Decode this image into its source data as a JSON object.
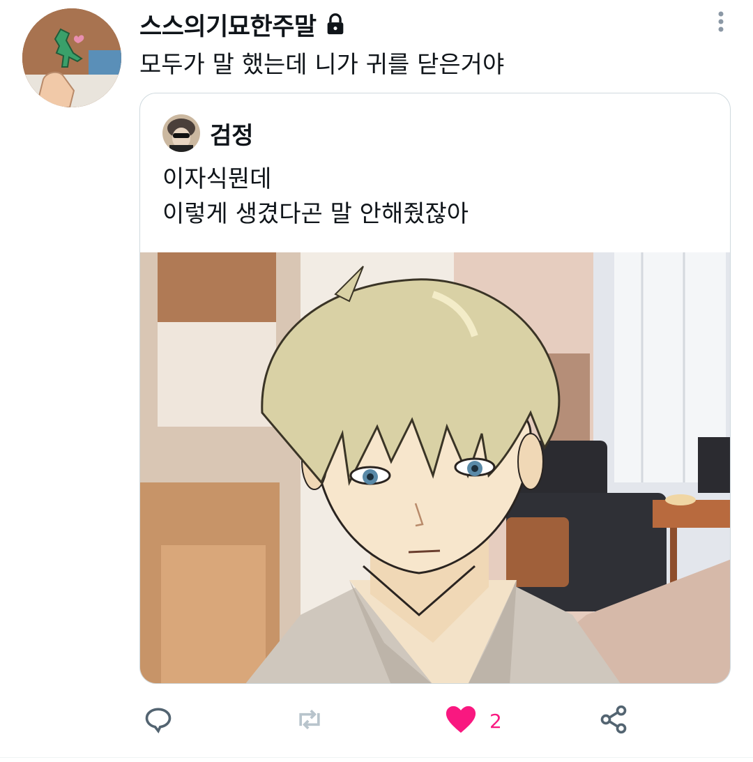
{
  "tweet": {
    "author_name": "스스의기묘한주말",
    "locked": true,
    "text": "모두가 말 했는데 니가 귀를 닫은거야",
    "icons": {
      "lock": "lock-icon",
      "menu": "more-vertical-icon"
    }
  },
  "quote": {
    "author_name": "검정",
    "text_lines": [
      "이자식뭔데",
      "이렇게 생겼다곤 말 안해줬잖아"
    ]
  },
  "actions": {
    "reply_icon": "reply-icon",
    "retweet_icon": "retweet-icon",
    "like_icon": "heart-filled-icon",
    "like_count": "2",
    "share_icon": "share-icon",
    "like_color": "#f91880",
    "icon_color": "#536471"
  }
}
